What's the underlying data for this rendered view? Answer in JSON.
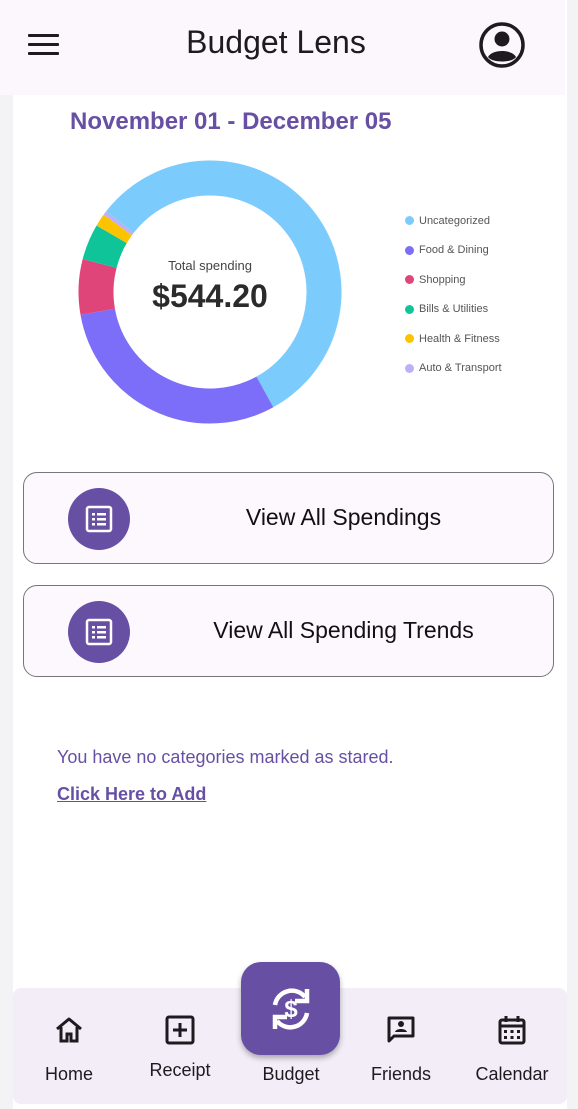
{
  "header": {
    "title": "Budget Lens"
  },
  "date_range": "November 01 - December 05",
  "summary": {
    "label": "Total spending",
    "total": "$544.20"
  },
  "chart_data": {
    "type": "pie",
    "categories": [
      "Uncategorized",
      "Food & Dining",
      "Shopping",
      "Bills & Utilities",
      "Health & Fitness",
      "Auto & Transport"
    ],
    "values": [
      307.5,
      164.5,
      37.0,
      24.0,
      8.5,
      2.7
    ],
    "colors": [
      "#7bcbfd",
      "#7c6ef8",
      "#e0457a",
      "#10c49a",
      "#fcc400",
      "#bcb1f7"
    ]
  },
  "legend": [
    {
      "label": "Uncategorized",
      "color": "#7bcbfd"
    },
    {
      "label": "Food & Dining",
      "color": "#7c6ef8"
    },
    {
      "label": "Shopping",
      "color": "#e0457a"
    },
    {
      "label": "Bills & Utilities",
      "color": "#10c49a"
    },
    {
      "label": "Health & Fitness",
      "color": "#fcc400"
    },
    {
      "label": "Auto & Transport",
      "color": "#bcb1f7"
    }
  ],
  "actions": [
    {
      "label": "View All Spendings"
    },
    {
      "label": "View All Spending Trends"
    }
  ],
  "starred": {
    "empty_message": "You have no categories marked as stared.",
    "add_link": "Click Here to Add"
  },
  "nav": {
    "home": "Home",
    "receipt": "Receipt",
    "budget": "Budget",
    "friends": "Friends",
    "calendar": "Calendar"
  },
  "accent_color": "#6750a4"
}
